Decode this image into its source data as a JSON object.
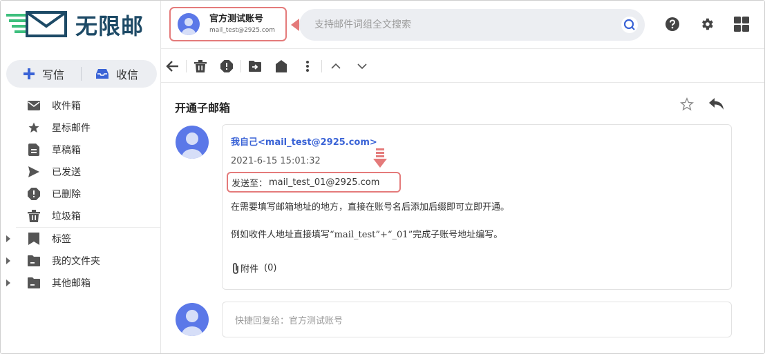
{
  "brand": {
    "logo_text": "无限邮",
    "accent": "#5b78e8",
    "logo_color": "#1d4a66",
    "logo_stripe": "#3dbf7d"
  },
  "compose": {
    "write_label": "写信",
    "read_label": "收信"
  },
  "folders": [
    {
      "label": "收件箱",
      "icon": "inbox-icon"
    },
    {
      "label": "星标邮件",
      "icon": "star-icon"
    },
    {
      "label": "草稿箱",
      "icon": "draft-icon"
    },
    {
      "label": "已发送",
      "icon": "send-icon"
    },
    {
      "label": "已删除",
      "icon": "deleted-icon"
    },
    {
      "label": "垃圾箱",
      "icon": "trash-icon"
    }
  ],
  "groups": [
    {
      "label": "标签",
      "icon": "tag-icon"
    },
    {
      "label": "我的文件夹",
      "icon": "folder-icon"
    },
    {
      "label": "其他邮箱",
      "icon": "mailbox-icon"
    }
  ],
  "account": {
    "name": "官方测试账号",
    "email": "mail_test@2925.com"
  },
  "search": {
    "placeholder": "支持邮件词组全文搜索"
  },
  "mail": {
    "subject": "开通子邮箱",
    "sender": "我自己<mail_test@2925.com>",
    "time": "2021-6-15 15:01:32",
    "to_label": "发送至：",
    "to_value": "mail_test_01@2925.com",
    "body_line1": "在需要填写邮箱地址的地方，直接在账号名后添加后缀即可立即开通。",
    "body_line2": "例如收件人地址直接填写“mail_test”+“_01”完成子账号地址编写。",
    "attachment_label": "附件",
    "attachment_count": "(0)"
  },
  "quick_reply": {
    "placeholder": "快捷回复给：官方测试账号"
  },
  "highlight_color": "#e47a7a"
}
